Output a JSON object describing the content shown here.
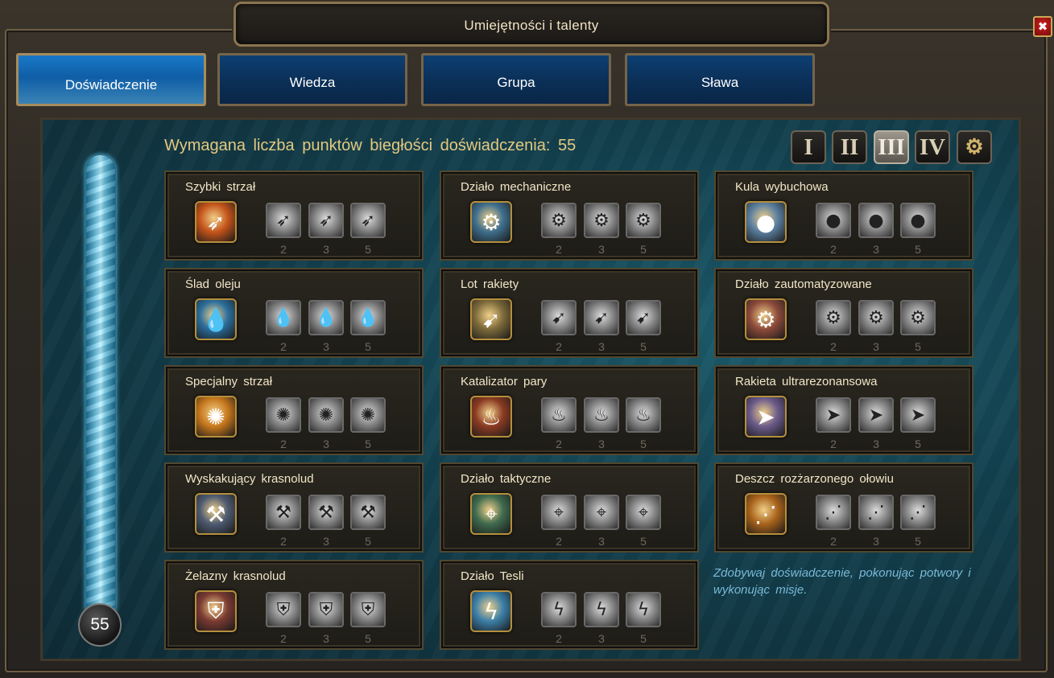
{
  "window": {
    "title": "Umiejętności i talenty",
    "close_label": "✖"
  },
  "tabs": [
    {
      "label": "Doświadczenie",
      "active": true
    },
    {
      "label": "Wiedza",
      "active": false
    },
    {
      "label": "Grupa",
      "active": false
    },
    {
      "label": "Sława",
      "active": false
    }
  ],
  "header": {
    "required_points_text": "Wymagana liczba punktów biegłości doświadczenia: 55"
  },
  "tiers": [
    {
      "label": "I",
      "active": false
    },
    {
      "label": "II",
      "active": false
    },
    {
      "label": "III",
      "active": true
    },
    {
      "label": "IV",
      "active": false
    },
    {
      "label": "⚙",
      "icon": "gears-icon",
      "active": false
    }
  ],
  "progress": {
    "level": "55",
    "fill_fraction": 1.0
  },
  "columns": [
    [
      {
        "name": "Szybki strzał",
        "icon": "flaming-arrow-icon",
        "color": "#c4541a",
        "upgrade_costs": [
          "2",
          "3",
          "5"
        ]
      },
      {
        "name": "Ślad oleju",
        "icon": "oil-drop-icon",
        "color": "#2b6e9c",
        "upgrade_costs": [
          "2",
          "3",
          "5"
        ]
      },
      {
        "name": "Specjalny strzał",
        "icon": "fireball-shot-icon",
        "color": "#c7781d",
        "upgrade_costs": [
          "2",
          "3",
          "5"
        ]
      },
      {
        "name": "Wyskakujący krasnolud",
        "icon": "jumping-dwarf-icon",
        "color": "#4d5a70",
        "upgrade_costs": [
          "2",
          "3",
          "5"
        ]
      },
      {
        "name": "Żelazny krasnolud",
        "icon": "iron-dwarf-icon",
        "color": "#7a3a32",
        "upgrade_costs": [
          "2",
          "3",
          "5"
        ]
      }
    ],
    [
      {
        "name": "Działo mechaniczne",
        "icon": "mechanical-cannon-icon",
        "color": "#3e6e8c",
        "upgrade_costs": [
          "2",
          "3",
          "5"
        ]
      },
      {
        "name": "Lot rakiety",
        "icon": "rocket-flight-icon",
        "color": "#7d6a3a",
        "upgrade_costs": [
          "2",
          "3",
          "5"
        ]
      },
      {
        "name": "Katalizator pary",
        "icon": "steam-catalyst-icon",
        "color": "#8a3a22",
        "upgrade_costs": [
          "2",
          "3",
          "5"
        ]
      },
      {
        "name": "Działo taktyczne",
        "icon": "tactical-cannon-icon",
        "color": "#3f6a4e",
        "upgrade_costs": [
          "2",
          "3",
          "5"
        ]
      },
      {
        "name": "Działo Tesli",
        "icon": "tesla-cannon-icon",
        "color": "#3c7fa8",
        "upgrade_costs": [
          "2",
          "3",
          "5"
        ]
      }
    ],
    [
      {
        "name": "Kula wybuchowa",
        "icon": "bomb-icon",
        "color": "#5b7fa0",
        "upgrade_costs": [
          "2",
          "3",
          "5"
        ]
      },
      {
        "name": "Działo zautomatyzowane",
        "icon": "automated-cannon-icon",
        "color": "#8c4a3a",
        "upgrade_costs": [
          "2",
          "3",
          "5"
        ]
      },
      {
        "name": "Rakieta ultrarezonansowa",
        "icon": "ultra-rocket-icon",
        "color": "#6a5a8a",
        "upgrade_costs": [
          "2",
          "3",
          "5"
        ]
      },
      {
        "name": "Deszcz rozżarzonego ołowiu",
        "icon": "lead-rain-icon",
        "color": "#a8621a",
        "upgrade_costs": [
          "2",
          "3",
          "5"
        ]
      }
    ]
  ],
  "info_text": "Zdobywaj doświadczenie, pokonując potwory i wykonując misje."
}
